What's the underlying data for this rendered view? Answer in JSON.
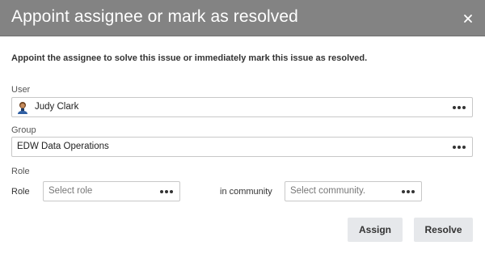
{
  "dialog": {
    "title": "Appoint assignee or mark as resolved",
    "close_icon": "close-icon",
    "intro": "Appoint the assignee to solve this issue or immediately mark this issue as resolved."
  },
  "user": {
    "label": "User",
    "value": "Judy Clark",
    "avatar_icon": "user-avatar"
  },
  "group": {
    "label": "Group",
    "value": "EDW Data Operations"
  },
  "role_section": {
    "heading": "Role",
    "role_label": "Role",
    "role_placeholder": "Select role",
    "community_label": "in community",
    "community_placeholder": "Select community."
  },
  "actions": {
    "assign_label": "Assign",
    "resolve_label": "Resolve"
  },
  "colors": {
    "header_bg": "#838383",
    "button_bg": "#e6e8eb"
  }
}
